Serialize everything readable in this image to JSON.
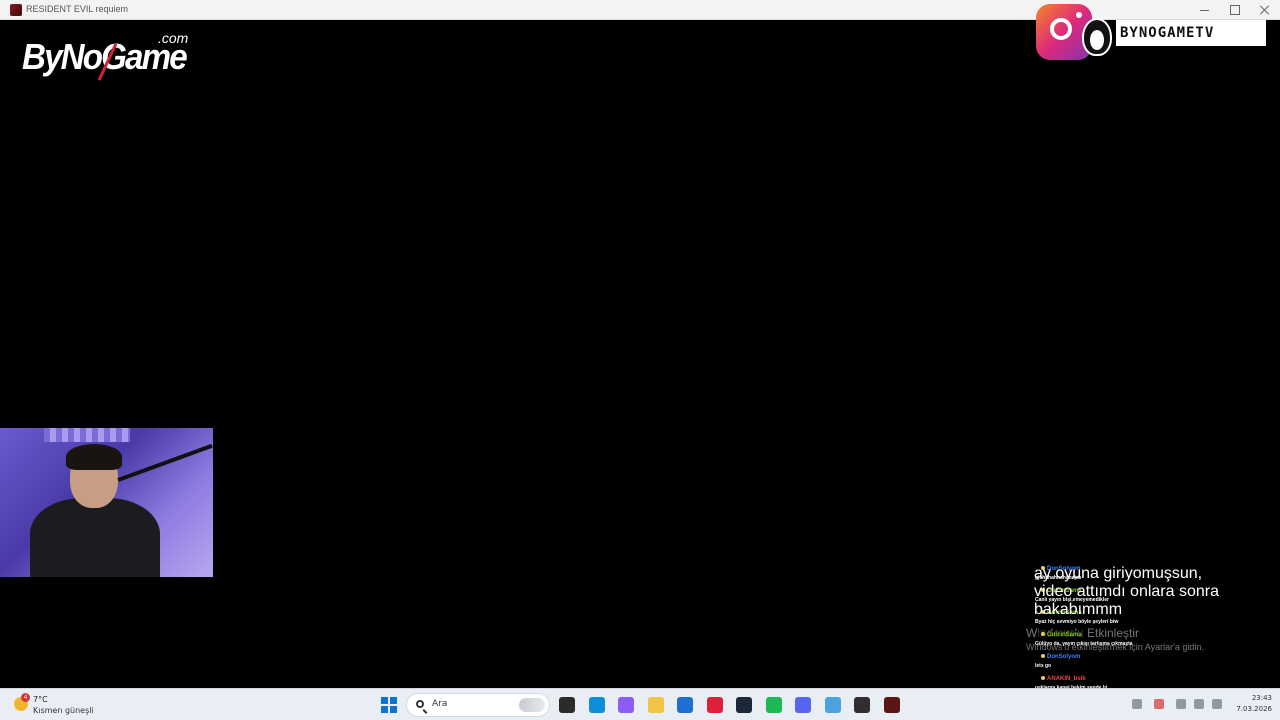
{
  "window": {
    "title": "RESIDENT EVIL requiem"
  },
  "overlay": {
    "logo_text": "ByNoGame",
    "logo_suffix": ".com",
    "social_handle": "BYNOGAMETV"
  },
  "chat": {
    "messages": [
      {
        "user": "DonSolyom",
        "user_color": "#3b82f6",
        "text": "gjahahahhahahajas"
      },
      {
        "user": "GulcinSama",
        "user_color": "#84cc16",
        "text": "Canlı yayın bişi,emeyemedikler"
      },
      {
        "user": "GulcinSama",
        "user_color": "#84cc16",
        "text": "Byaz hiç sevmiyo böyle şeyleri btw"
      },
      {
        "user": "GulcinSama",
        "user_color": "#84cc16",
        "text": "Gülüyo da, yayın çıkışı tartışma çıkmaşta"
      },
      {
        "user": "DonSolyom",
        "user_color": "#3b82f6",
        "text": "lets go"
      },
      {
        "user": "ANAKIN_bslk",
        "user_color": "#ef4444",
        "text": "ışıklarını kapat bekim sende bi"
      },
      {
        "user": "GulcinSama",
        "user_color": "#84cc16",
        "text": "ay oyuna giriyomuşsun, video attımdı onlara sonra bakabımmm"
      }
    ]
  },
  "activation_watermark": {
    "title": "Windows'u Etkinleştir",
    "subtitle": "Windows'u etkinleştirmek için Ayarlar'a gidin."
  },
  "taskbar": {
    "weather": {
      "badge": "4",
      "temp": "7°C",
      "condition": "Kısmen güneşli"
    },
    "search_placeholder": "Ara",
    "clock": {
      "time": "23:43",
      "date": "7.03.2026"
    },
    "apps": [
      {
        "name": "task-view-icon",
        "color": "#2b2b2b"
      },
      {
        "name": "edge-icon",
        "color": "#0c8fd8"
      },
      {
        "name": "copilot-icon",
        "color": "#8b5cf6"
      },
      {
        "name": "file-explorer-icon",
        "color": "#f4c542"
      },
      {
        "name": "store-icon",
        "color": "#1f6fd1"
      },
      {
        "name": "opera-icon",
        "color": "#e0203a"
      },
      {
        "name": "steam-icon",
        "color": "#1b2838"
      },
      {
        "name": "spotify-icon",
        "color": "#1db954"
      },
      {
        "name": "discord-icon",
        "color": "#5865f2"
      },
      {
        "name": "network-app-icon",
        "color": "#4aa3df"
      },
      {
        "name": "obs-icon",
        "color": "#302e31"
      },
      {
        "name": "resident-evil-icon",
        "color": "#5a1515"
      }
    ]
  }
}
